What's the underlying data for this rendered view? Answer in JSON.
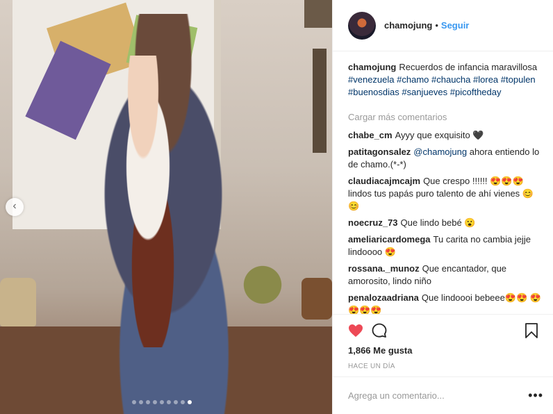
{
  "post": {
    "author": "chamojung",
    "separator": "•",
    "follow_label": "Seguir",
    "caption_user": "chamojung",
    "caption_text": "Recuerdos de infancia maravillosa",
    "hashtags": [
      "#venezuela",
      "#chamo",
      "#chaucha",
      "#lorea",
      "#topulen",
      "#buenosdias",
      "#sanjueves",
      "#picoftheday"
    ],
    "load_more_label": "Cargar más comentarios",
    "carousel": {
      "count": 9,
      "active_index": 8
    }
  },
  "comments": [
    {
      "user": "chabe_cm",
      "text": "Ayyy que exquisito 🖤"
    },
    {
      "user": "patitagonsalez",
      "mention": "@chamojung",
      "text": "ahora entiendo lo de chamo.(*-*)"
    },
    {
      "user": "claudiacajmcajm",
      "text": "Que crespo !!!!!! 😍😍😍 lindos tus papás puro talento de ahí vienes 😊😊"
    },
    {
      "user": "noecruz_73",
      "text": "Que lindo bebé 😮"
    },
    {
      "user": "ameliaricardomega",
      "text": "Tu carita no cambia jejje lindoooo 😍"
    },
    {
      "user": "rossana._munoz",
      "text": "Que encantador, que amorosito, lindo niño"
    },
    {
      "user": "penalozaadriana",
      "text": "Que lindoooi bebeee😍😍 😍😍😍😍"
    }
  ],
  "actions": {
    "likes_label": "1,866 Me gusta",
    "time_label": "HACE UN DÍA",
    "like_color": "#ed4956"
  },
  "add_comment": {
    "placeholder": "Agrega un comentario...",
    "more_label": "•••"
  },
  "icons": {
    "prev": "chevron-left-icon",
    "like": "heart-icon",
    "comment": "comment-icon",
    "save": "bookmark-icon",
    "more": "more-options-icon"
  }
}
